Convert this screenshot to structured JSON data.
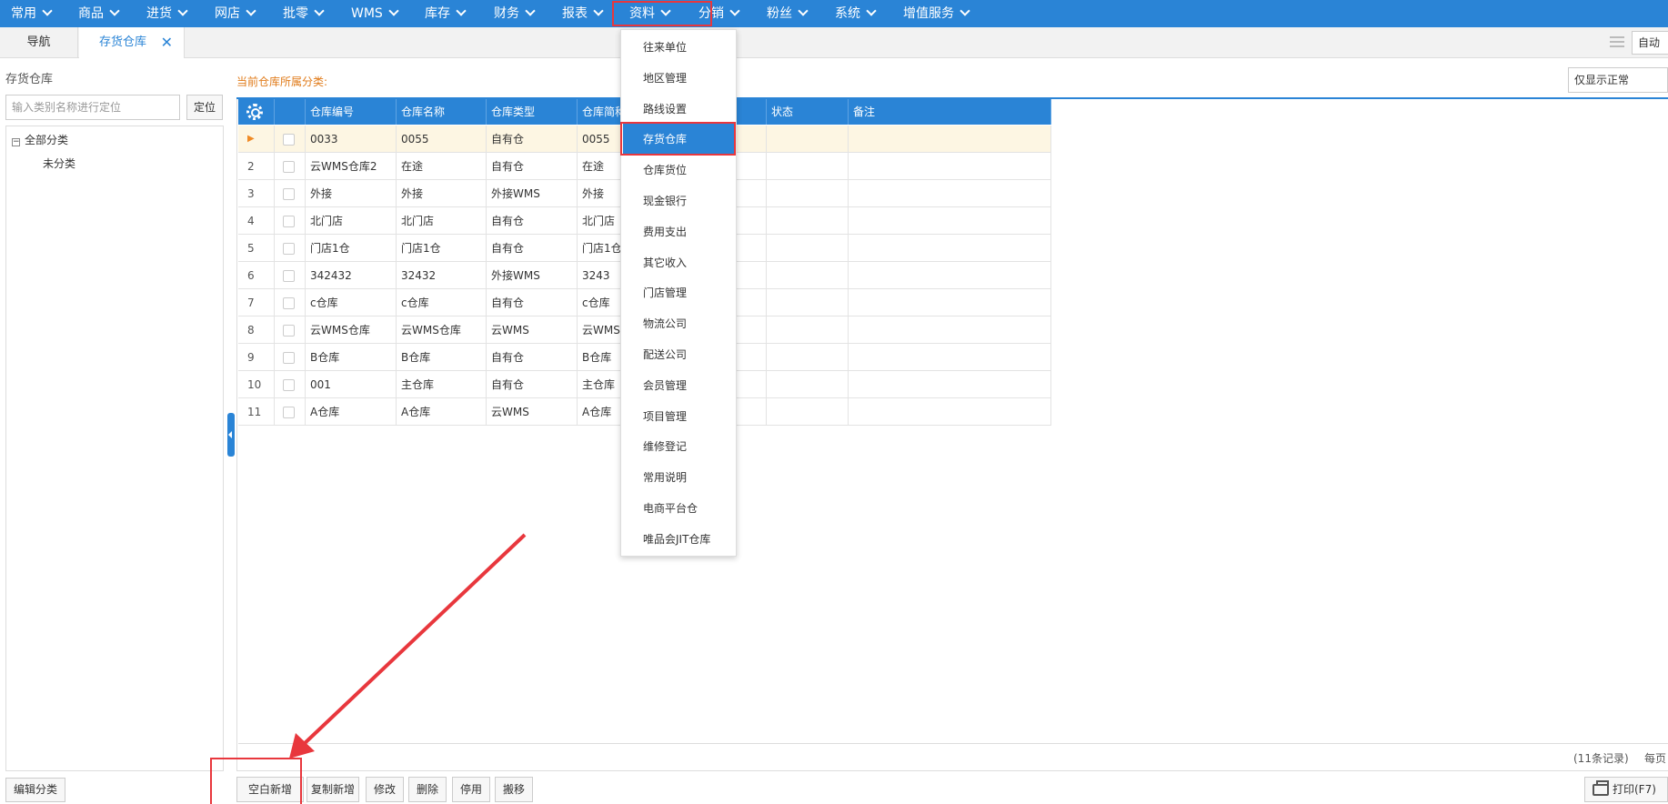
{
  "nav": {
    "items": [
      {
        "label": "常用"
      },
      {
        "label": "商品"
      },
      {
        "label": "进货"
      },
      {
        "label": "网店"
      },
      {
        "label": "批零"
      },
      {
        "label": "WMS"
      },
      {
        "label": "库存"
      },
      {
        "label": "财务"
      },
      {
        "label": "报表"
      },
      {
        "label": "资料"
      },
      {
        "label": "分销"
      },
      {
        "label": "粉丝"
      },
      {
        "label": "系统"
      },
      {
        "label": "增值服务"
      }
    ]
  },
  "tabs": {
    "nav_label": "导航",
    "active_label": "存货仓库",
    "close": "✕",
    "right_label": "自动"
  },
  "left": {
    "title": "存货仓库",
    "search_placeholder": "输入类别名称进行定位",
    "locate_label": "定位",
    "tree_root": "全部分类",
    "tree_toggle": "−",
    "tree_child": "未分类",
    "edit_category_label": "编辑分类"
  },
  "main": {
    "category_label": "当前仓库所属分类:",
    "filter_value": "仅显示正常",
    "columns": [
      "仓库编号",
      "仓库名称",
      "仓库类型",
      "仓库简称",
      "状态",
      "备注"
    ],
    "rows": [
      {
        "num": "▶",
        "code": "0033",
        "name": "0055",
        "type": "自有仓",
        "short": "0055"
      },
      {
        "num": "2",
        "code": "云WMS仓库2",
        "name": "在途",
        "type": "自有仓",
        "short": "在途"
      },
      {
        "num": "3",
        "code": "外接",
        "name": "外接",
        "type": "外接WMS",
        "short": "外接"
      },
      {
        "num": "4",
        "code": "北门店",
        "name": "北门店",
        "type": "自有仓",
        "short": "北门店"
      },
      {
        "num": "5",
        "code": "门店1仓",
        "name": "门店1仓",
        "type": "自有仓",
        "short": "门店1仓"
      },
      {
        "num": "6",
        "code": "342432",
        "name": "32432",
        "type": "外接WMS",
        "short": "3243"
      },
      {
        "num": "7",
        "code": "c仓库",
        "name": "c仓库",
        "type": "自有仓",
        "short": "c仓库"
      },
      {
        "num": "8",
        "code": "云WMS仓库",
        "name": "云WMS仓库",
        "type": "云WMS",
        "short": "云WMS"
      },
      {
        "num": "9",
        "code": "B仓库",
        "name": "B仓库",
        "type": "自有仓",
        "short": "B仓库"
      },
      {
        "num": "10",
        "code": "001",
        "name": "主仓库",
        "type": "自有仓",
        "short": "主仓库"
      },
      {
        "num": "11",
        "code": "A仓库",
        "name": "A仓库",
        "type": "云WMS",
        "short": "A仓库"
      }
    ],
    "records_label": "(11条记录)",
    "per_page_label": "每页"
  },
  "toolbar": {
    "buttons": [
      "空白新增",
      "复制新增",
      "修改",
      "删除",
      "停用",
      "搬移"
    ],
    "print_label": "打印(F7)"
  },
  "dropdown": {
    "items": [
      "往来单位",
      "地区管理",
      "路线设置",
      "存货仓库",
      "仓库货位",
      "现金银行",
      "费用支出",
      "其它收入",
      "门店管理",
      "物流公司",
      "配送公司",
      "会员管理",
      "项目管理",
      "维修登记",
      "常用说明",
      "电商平台仓",
      "唯品会JIT仓库"
    ],
    "active_index": 3
  },
  "colors": {
    "primary": "#2a84d6",
    "highlight_red": "#e8373d",
    "category_label": "#e07b1a"
  }
}
